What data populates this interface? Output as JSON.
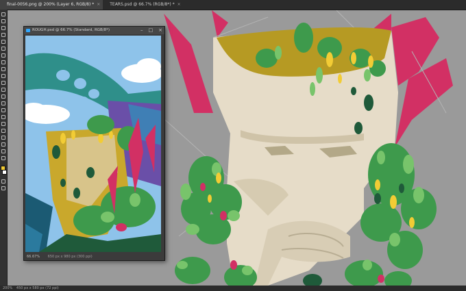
{
  "tabs": [
    {
      "label": "final-0056.png @ 200% (Layer 6, RGB/8) *",
      "active": true
    },
    {
      "label": "TEARS.psd @ 66.7% (RGB/8*) *",
      "active": false
    }
  ],
  "floating_window": {
    "title": "ROUGH.psd @ 66.7% (Standard, RGB/8*)",
    "zoom": "66.67%",
    "dimensions": "650 px x 980 px (300 ppi)"
  },
  "statusbar": {
    "zoom": "200%",
    "info": "450 px x 580 px (72 ppi)"
  },
  "colors": {
    "accent": "#31a8ff",
    "mask": "#e6dcc8",
    "magenta": "#d23064",
    "green": "#3e9a4c",
    "dark_green": "#1f5a3a",
    "mustard": "#b69a23",
    "yellow": "#f2cc35",
    "canvas_gray": "#9a9a9a"
  }
}
